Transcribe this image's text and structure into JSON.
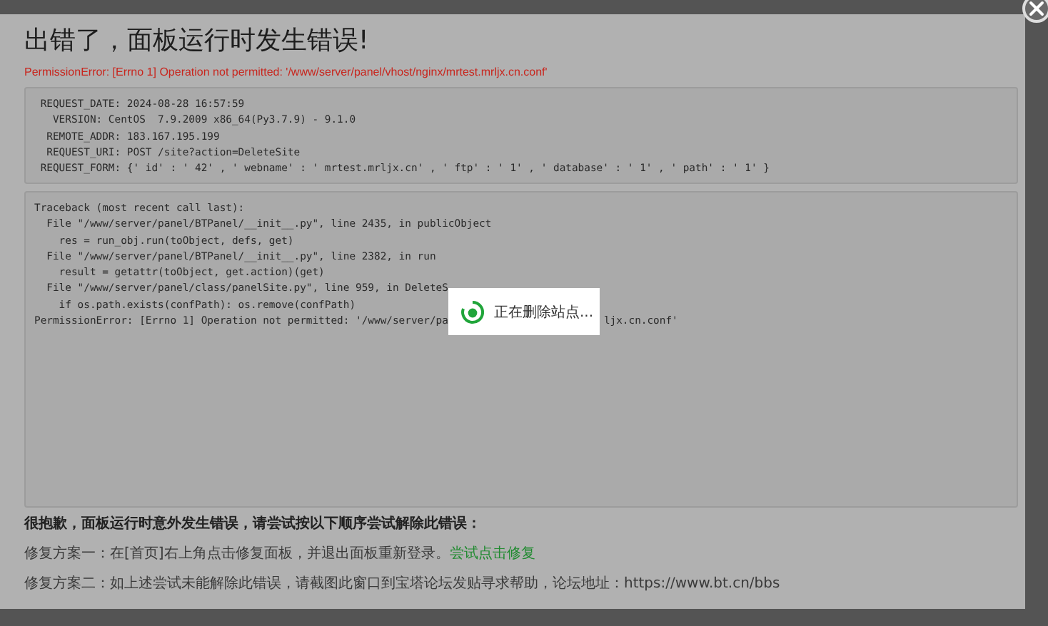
{
  "dialog": {
    "title": "出错了，面板运行时发生错误!",
    "error_message": "PermissionError: [Errno 1] Operation not permitted: '/www/server/panel/vhost/nginx/mrtest.mrljx.cn.conf'",
    "request_info": [
      " REQUEST_DATE: 2024-08-28 16:57:59",
      "   VERSION: CentOS  7.9.2009 x86_64(Py3.7.9) - 9.1.0",
      "  REMOTE_ADDR: 183.167.195.199",
      "  REQUEST_URI: POST /site?action=DeleteSite",
      " REQUEST_FORM: {' id' : ' 42' , ' webname' : ' mrtest.mrljx.cn' , ' ftp' : ' 1' , ' database' : ' 1' , ' path' : ' 1' }"
    ],
    "traceback": [
      "Traceback (most recent call last):",
      "  File \"/www/server/panel/BTPanel/__init__.py\", line 2435, in publicObject",
      "    res = run_obj.run(toObject, defs, get)",
      "  File \"/www/server/panel/BTPanel/__init__.py\", line 2382, in run",
      "    result = getattr(toObject, get.action)(get)",
      "  File \"/www/server/panel/class/panelSite.py\", line 959, in DeleteS",
      "    if os.path.exists(confPath): os.remove(confPath)",
      "PermissionError: [Errno 1] Operation not permitted: '/www/server/pa"
    ],
    "traceback_tail": "ljx.cn.conf'",
    "help_intro": "很抱歉，面板运行时意外发生错误，请尝试按以下顺序尝试解除此错误：",
    "fix_one": {
      "text": "修复方案一：在[首页]右上角点击修复面板，并退出面板重新登录。",
      "link": "尝试点击修复"
    },
    "fix_two": "修复方案二：如上述尝试未能解除此错误，请截图此窗口到宝塔论坛发贴寻求帮助，论坛地址：https://www.bt.cn/bbs"
  },
  "loading_toast": {
    "text": "正在删除站点..."
  }
}
